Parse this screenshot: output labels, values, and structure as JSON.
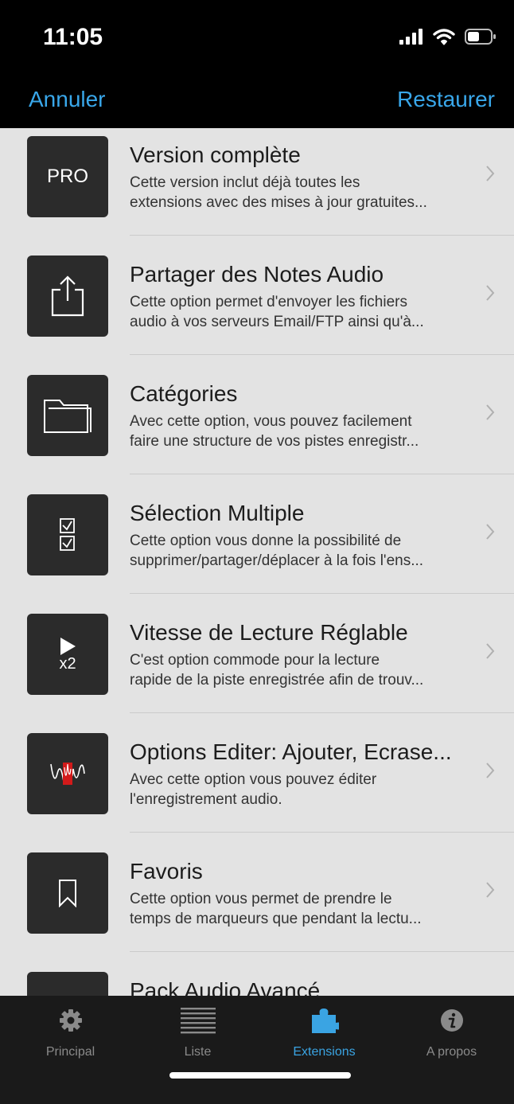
{
  "status": {
    "time": "11:05"
  },
  "nav": {
    "cancel": "Annuler",
    "restore": "Restaurer"
  },
  "items": [
    {
      "icon": "pro-icon",
      "icon_text": "PRO",
      "title": "Version complète",
      "line1": "Cette version inclut déjà toutes les",
      "line2": "extensions avec des mises à jour gratuites..."
    },
    {
      "icon": "share-icon",
      "title": "Partager des Notes Audio",
      "line1": "Cette option permet d'envoyer les fichiers",
      "line2": "audio à vos serveurs Email/FTP ainsi qu'à..."
    },
    {
      "icon": "folder-icon",
      "title": "Catégories",
      "line1": "Avec cette option, vous pouvez facilement",
      "line2": "faire une structure de vos pistes enregistr..."
    },
    {
      "icon": "checklist-icon",
      "title": "Sélection Multiple",
      "line1": "Cette option vous donne la possibilité de",
      "line2": "supprimer/partager/déplacer à la fois l'ens..."
    },
    {
      "icon": "play-speed-icon",
      "icon_text": "x2",
      "title": "Vitesse de Lecture Réglable",
      "line1": "C'est option commode pour la lecture",
      "line2": "rapide de la piste enregistrée afin de trouv..."
    },
    {
      "icon": "waveform-edit-icon",
      "title": "Options Editer: Ajouter, Ecrase...",
      "line1": "Avec cette option vous pouvez éditer",
      "line2": "l'enregistrement audio."
    },
    {
      "icon": "bookmark-icon",
      "title": "Favoris",
      "line1": "Cette option vous permet de prendre le",
      "line2": "temps de marqueurs que pendant la lectu..."
    },
    {
      "icon": "audio-pack-icon",
      "title": "Pack Audio Avancé",
      "line1": "",
      "line2": ""
    }
  ],
  "tabs": [
    {
      "label": "Principal",
      "icon": "gear-icon"
    },
    {
      "label": "Liste",
      "icon": "list-icon"
    },
    {
      "label": "Extensions",
      "icon": "puzzle-icon"
    },
    {
      "label": "A propos",
      "icon": "info-icon"
    }
  ],
  "colors": {
    "accent": "#39a7ea",
    "tab_active": "#3aa4e3",
    "list_bg": "#e3e3e3",
    "thumb_bg": "#2b2b2b"
  }
}
